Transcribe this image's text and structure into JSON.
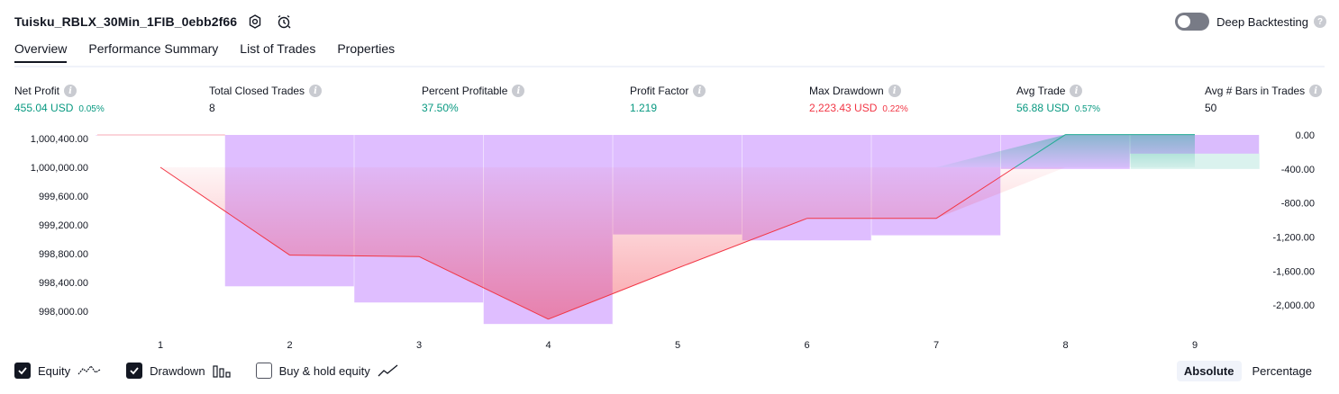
{
  "header": {
    "title": "Tuisku_RBLX_30Min_1FIB_0ebb2f66",
    "deep_backtesting_label": "Deep Backtesting",
    "deep_backtesting_enabled": false
  },
  "tabs": [
    {
      "label": "Overview",
      "active": true
    },
    {
      "label": "Performance Summary",
      "active": false
    },
    {
      "label": "List of Trades",
      "active": false
    },
    {
      "label": "Properties",
      "active": false
    }
  ],
  "metrics": {
    "net_profit": {
      "label": "Net Profit",
      "value": "455.04 USD",
      "pct": "0.05%"
    },
    "total_closed_trades": {
      "label": "Total Closed Trades",
      "value": "8"
    },
    "percent_profitable": {
      "label": "Percent Profitable",
      "value": "37.50%"
    },
    "profit_factor": {
      "label": "Profit Factor",
      "value": "1.219"
    },
    "max_drawdown": {
      "label": "Max Drawdown",
      "value": "2,223.43 USD",
      "pct": "0.22%"
    },
    "avg_trade": {
      "label": "Avg Trade",
      "value": "56.88 USD",
      "pct": "0.57%"
    },
    "avg_bars": {
      "label": "Avg # Bars in Trades",
      "value": "50"
    }
  },
  "chart_data": {
    "type": "line",
    "x": [
      1,
      2,
      3,
      4,
      5,
      6,
      7,
      8,
      9
    ],
    "x_ticks": [
      "1",
      "2",
      "3",
      "4",
      "5",
      "6",
      "7",
      "8",
      "9"
    ],
    "left_ticks": [
      "1,000,400.00",
      "1,000,000.00",
      "999,600.00",
      "999,200.00",
      "998,800.00",
      "998,400.00",
      "998,000.00"
    ],
    "right_ticks": [
      "0.00",
      "-400.00",
      "-800.00",
      "-1,200.00",
      "-1,600.00",
      "-2,000.00"
    ],
    "left_ylim": [
      997850,
      1000450
    ],
    "right_ylim": [
      -2200,
      0
    ],
    "initial_capital": 1000000,
    "series": [
      {
        "name": "Equity",
        "x": [
          1,
          2,
          3,
          4,
          5,
          6,
          7,
          8,
          9
        ],
        "values": [
          1000000,
          998780,
          998760,
          997890,
          998600,
          999290,
          999290,
          1000455,
          1000455
        ]
      },
      {
        "name": "Drawdown",
        "x": [
          1.5,
          2.5,
          3.5,
          4.5,
          5.5,
          6.5,
          7.5,
          8.5,
          9.5
        ],
        "values": [
          0,
          -1780,
          -1970,
          -2223,
          -1170,
          -1240,
          -1180,
          -400,
          -220
        ]
      }
    ],
    "buy_hold_bars": [
      {
        "from": 8.5,
        "to": 9.5,
        "values": [
          -400
        ]
      }
    ],
    "colors": {
      "equity_line": "#f23645",
      "equity_line_up": "#22ab94",
      "drawdown_fill": "#d9b3ff",
      "buy_hold_fill": "#daf2ee",
      "grid": "#e0e3eb"
    }
  },
  "footer": {
    "equity_label": "Equity",
    "equity_checked": true,
    "drawdown_label": "Drawdown",
    "drawdown_checked": true,
    "buyhold_label": "Buy & hold equity",
    "buyhold_checked": false,
    "absolute_label": "Absolute",
    "percentage_label": "Percentage",
    "mode": "absolute"
  }
}
